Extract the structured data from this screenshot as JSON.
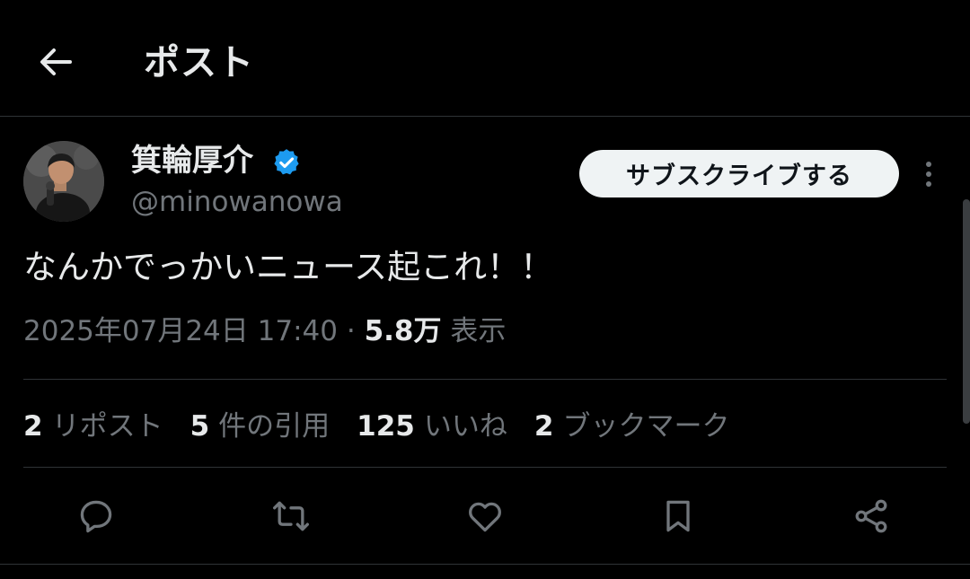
{
  "header": {
    "title": "ポスト"
  },
  "author": {
    "display_name": "箕輪厚介",
    "handle": "@minowanowa",
    "verified": true,
    "verified_color": "#1d9bf0"
  },
  "subscribe_button": {
    "label": "サブスクライブする"
  },
  "tweet": {
    "text": "なんかでっかいニュース起これ！！",
    "timestamp": "2025年07月24日 17:40",
    "separator": "·",
    "views_count": "5.8万",
    "views_label": "表示"
  },
  "stats": [
    {
      "count": "2",
      "label": "リポスト"
    },
    {
      "count": "5",
      "label": "件の引用"
    },
    {
      "count": "125",
      "label": "いいね"
    },
    {
      "count": "2",
      "label": "ブックマーク"
    }
  ],
  "actions": {
    "reply_icon": "reply-icon",
    "repost_icon": "repost-icon",
    "like_icon": "heart-icon",
    "bookmark_icon": "bookmark-icon",
    "share_icon": "share-icon"
  },
  "colors": {
    "background": "#000000",
    "text_primary": "#e7e9ea",
    "text_secondary": "#71767b",
    "divider": "#2f3336"
  }
}
